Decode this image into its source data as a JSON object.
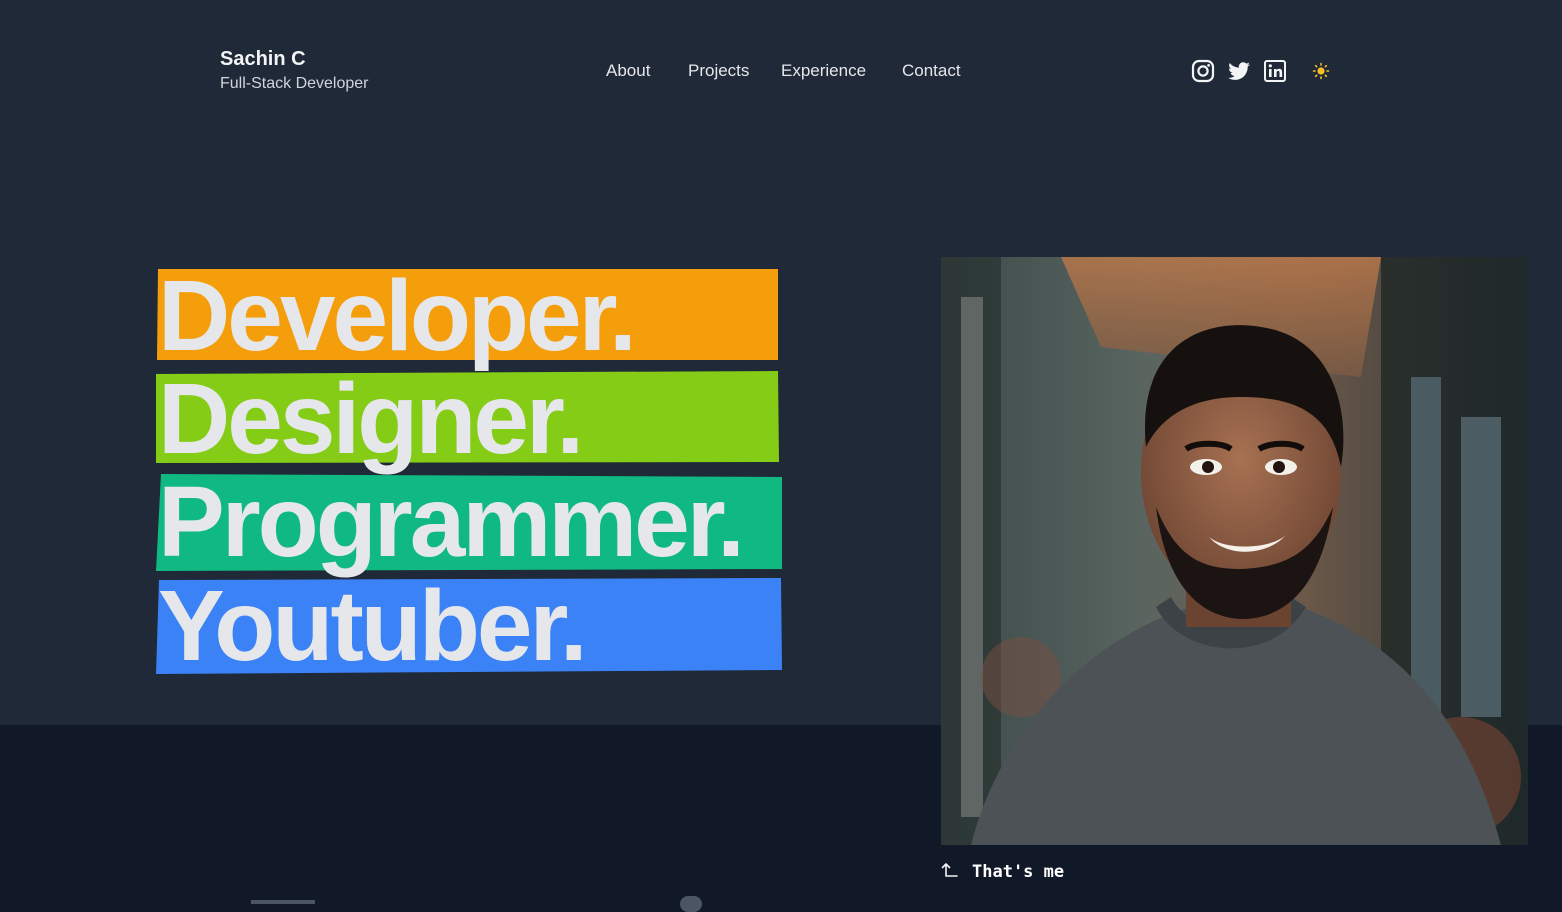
{
  "brand": {
    "name": "Sachin C",
    "subtitle": "Full-Stack Developer"
  },
  "nav": [
    {
      "label": "About"
    },
    {
      "label": "Projects"
    },
    {
      "label": "Experience"
    },
    {
      "label": "Contact"
    }
  ],
  "socials": [
    {
      "icon": "instagram-icon"
    },
    {
      "icon": "twitter-icon"
    },
    {
      "icon": "linkedin-icon"
    }
  ],
  "theme_toggle": {
    "icon": "sun-icon",
    "color": "#fbbf24"
  },
  "hero": {
    "words": [
      {
        "text": "Developer.",
        "color": "#f59e0b"
      },
      {
        "text": "Designer.",
        "color": "#84cc16"
      },
      {
        "text": "Programmer.",
        "color": "#10b981"
      },
      {
        "text": "Youtuber.",
        "color": "#3b82f6"
      }
    ]
  },
  "photo": {
    "caption": "That's me"
  },
  "colors": {
    "header_bg": "#1f2937",
    "page_bg": "#111827",
    "text": "#e5e7eb"
  }
}
